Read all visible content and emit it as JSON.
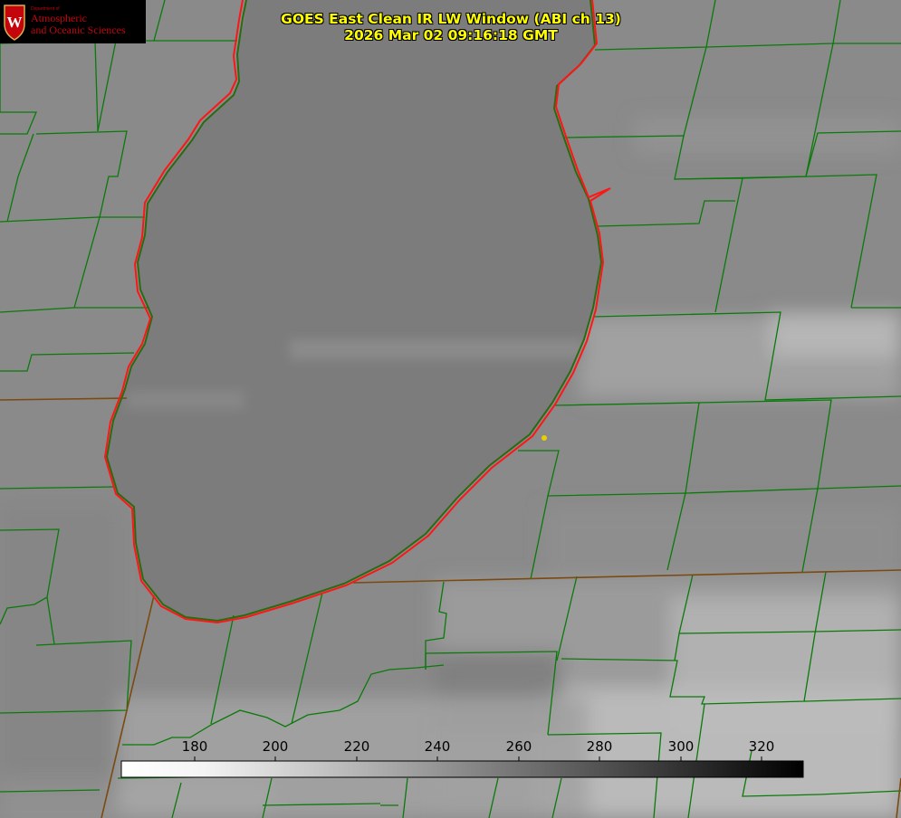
{
  "logo": {
    "crest_letter": "W",
    "department_line": "Department of",
    "name_line1": "Atmospheric",
    "name_line2": "and Oceanic Sciences"
  },
  "title": {
    "line1": "GOES East Clean IR LW Window (ABI ch 13)",
    "line2": "2026 Mar 02 09:16:18 GMT"
  },
  "colorbar": {
    "ticks": [
      "180",
      "200",
      "220",
      "240",
      "260",
      "280",
      "300",
      "320"
    ],
    "gradient_from": "#ffffff",
    "gradient_to": "#000000"
  },
  "colors": {
    "background_gray": "#888888",
    "lake_gray": "#7b7b7b",
    "county_lines": "#0a7a0a",
    "state_lines": "#7a4a10",
    "shoreline": "#ff1010",
    "marker": "#e8d000",
    "title_text": "#ffff00"
  }
}
